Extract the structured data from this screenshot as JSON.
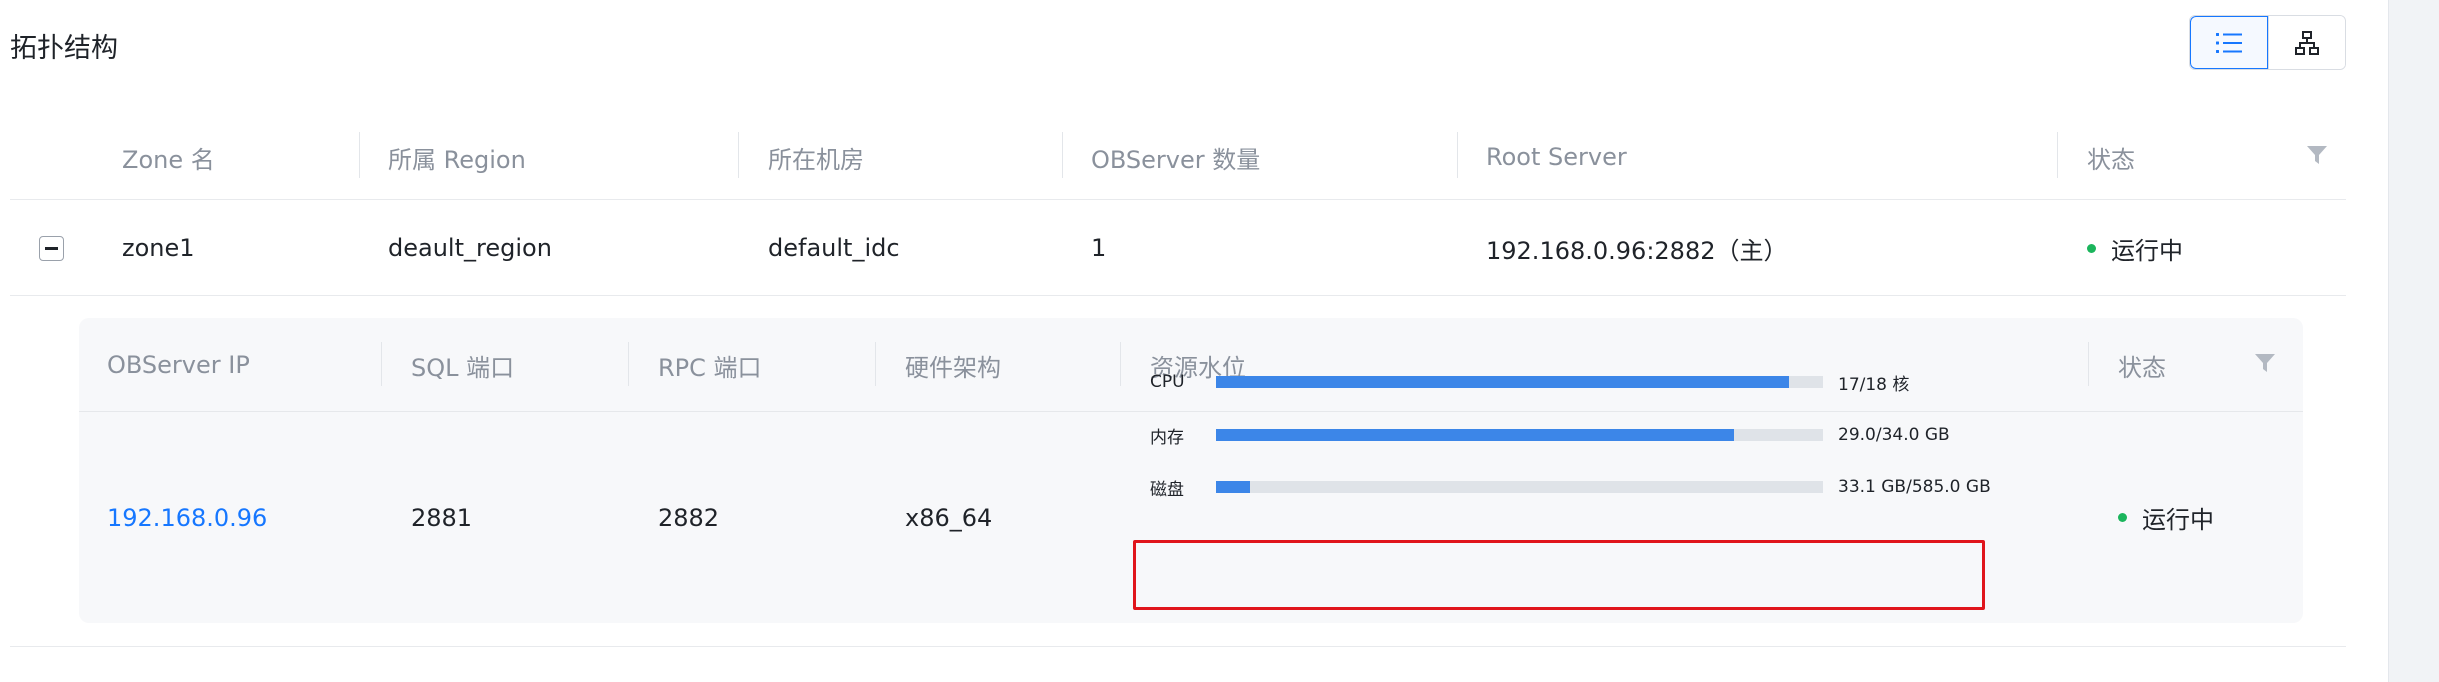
{
  "page": {
    "title": "拓扑结构"
  },
  "colors": {
    "accent": "#1677ff",
    "status_running": "#1bb55c",
    "bar_fill": "#3c86e8",
    "bar_track": "#dfe3e8",
    "highlight": "#e0151c"
  },
  "view_switch": {
    "list_icon": "list-icon",
    "topology_icon": "topology-icon",
    "active": "list"
  },
  "zone_table": {
    "columns": [
      "Zone 名",
      "所属 Region",
      "所在机房",
      "OBServer 数量",
      "Root Server",
      "状态"
    ],
    "filter_icon": "filter-icon",
    "rows": [
      {
        "expand_icon": "collapse-icon",
        "zone": "zone1",
        "region": "deault_region",
        "idc": "default_idc",
        "observer_count": "1",
        "root_server": "192.168.0.96:2882（主）",
        "status": "运行中"
      }
    ]
  },
  "server_table": {
    "columns": [
      "OBServer IP",
      "SQL 端口",
      "RPC 端口",
      "硬件架构",
      "资源水位",
      "状态"
    ],
    "rows": [
      {
        "ip": "192.168.0.96",
        "sql_port": "2881",
        "rpc_port": "2882",
        "arch": "x86_64",
        "resources": [
          {
            "label": "CPU",
            "value": "17/18 核",
            "used": 17,
            "total": 18
          },
          {
            "label": "内存",
            "value": "29.0/34.0 GB",
            "used": 29.0,
            "total": 34.0
          },
          {
            "label": "磁盘",
            "value": "33.1 GB/585.0 GB",
            "used": 33.1,
            "total": 585.0
          }
        ],
        "status": "运行中"
      }
    ]
  }
}
